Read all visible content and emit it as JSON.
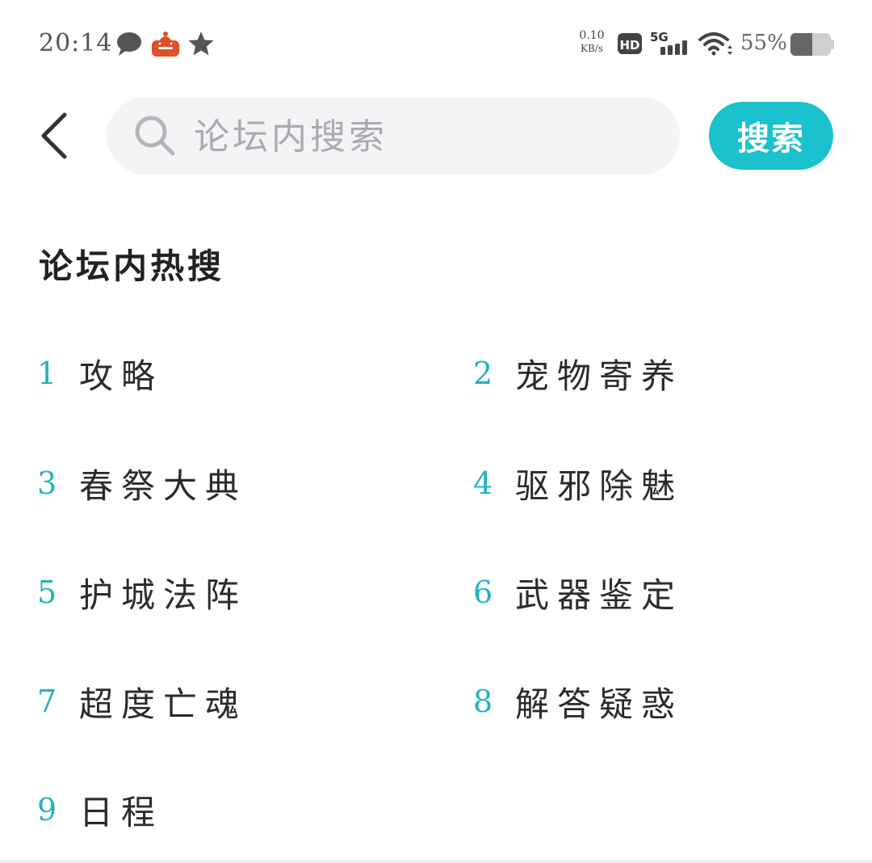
{
  "status_bar": {
    "time": "20:14",
    "net_speed_value": "0.10",
    "net_speed_unit": "KB/s",
    "hd_label": "HD",
    "network_label": "5G",
    "battery_percent": "55%",
    "icons": [
      "chat-bubble-icon",
      "app-notification-icon",
      "star-icon",
      "hd-icon",
      "signal-5g-icon",
      "wifi-icon",
      "battery-icon"
    ]
  },
  "header": {
    "search_placeholder": "论坛内搜索",
    "search_value": "",
    "search_button_label": "搜索"
  },
  "hot": {
    "title": "论坛内热搜",
    "items": [
      {
        "rank": "1",
        "label": "攻略"
      },
      {
        "rank": "2",
        "label": "宠物寄养"
      },
      {
        "rank": "3",
        "label": "春祭大典"
      },
      {
        "rank": "4",
        "label": "驱邪除魅"
      },
      {
        "rank": "5",
        "label": "护城法阵"
      },
      {
        "rank": "6",
        "label": "武器鉴定"
      },
      {
        "rank": "7",
        "label": "超度亡魂"
      },
      {
        "rank": "8",
        "label": "解答疑惑"
      },
      {
        "rank": "9",
        "label": "日程"
      }
    ]
  },
  "colors": {
    "accent": "#19c2cc",
    "rank_number": "#24b3bd",
    "search_bg": "#f3f4f6"
  }
}
